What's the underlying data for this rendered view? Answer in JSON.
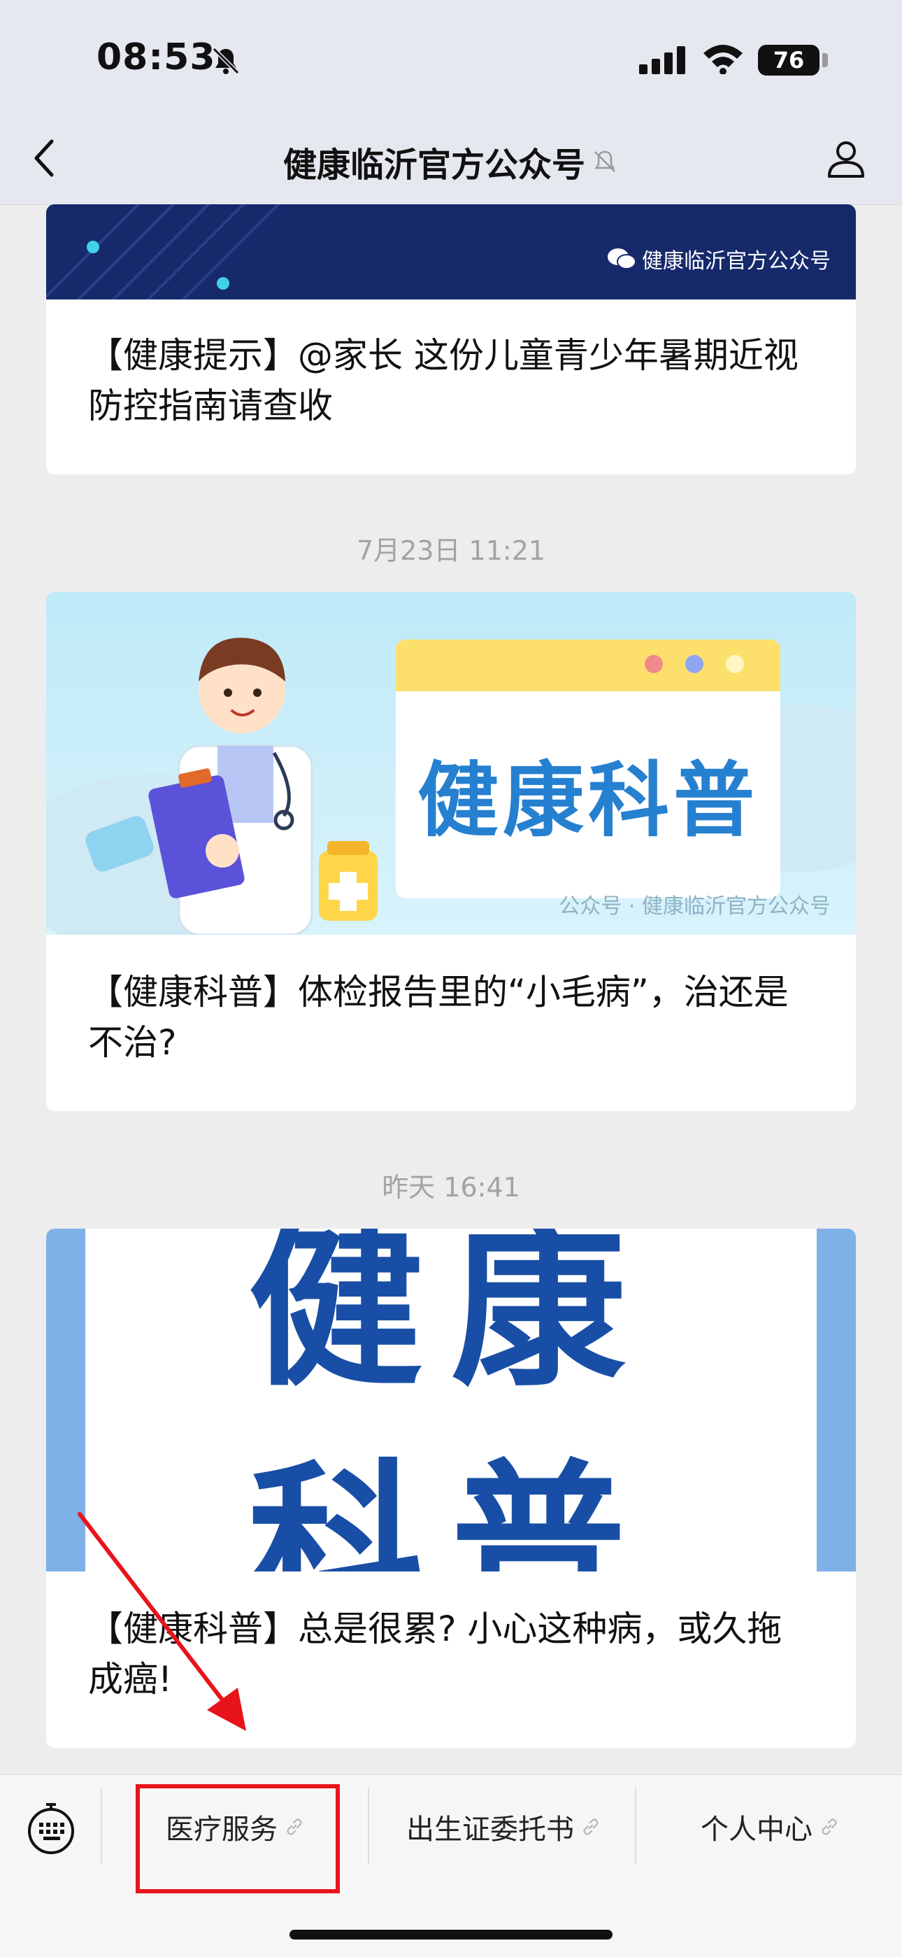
{
  "status_bar": {
    "time": "08:53",
    "battery": "76"
  },
  "nav": {
    "title": "健康临沂官方公众号"
  },
  "articles": [
    {
      "watermark": "健康临沂官方公众号",
      "title_line1": "【健康提示】@家长 这份儿童青少年暑期近视",
      "title_line2": "防控指南请查收"
    },
    {
      "timestamp": "7月23日 11:21",
      "banner_text": "健康科普",
      "watermark": "公众号 · 健康临沂官方公众号",
      "title_line1": "【健康科普】体检报告里的“小毛病”，治还是",
      "title_line2": "不治?"
    },
    {
      "timestamp": "昨天 16:41",
      "banner_line1": "健康",
      "banner_line2": "科普",
      "title_line1": "【健康科普】总是很累? 小心这种病，或久拖",
      "title_line2": "成癌!"
    }
  ],
  "menu": {
    "items": [
      {
        "label": "医疗服务"
      },
      {
        "label": "出生证委托书"
      },
      {
        "label": "个人中心"
      }
    ]
  },
  "colors": {
    "accent_red": "#e8141b",
    "banner_blue": "#2680d0",
    "banner_dark": "#16296b"
  }
}
